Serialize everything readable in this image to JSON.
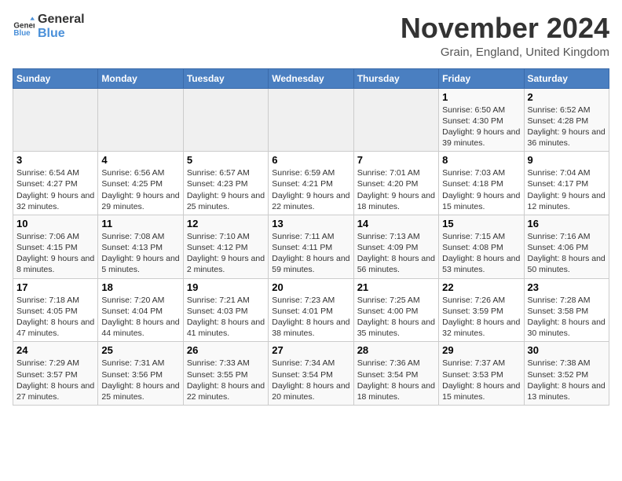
{
  "header": {
    "logo_line1": "General",
    "logo_line2": "Blue",
    "month": "November 2024",
    "location": "Grain, England, United Kingdom"
  },
  "weekdays": [
    "Sunday",
    "Monday",
    "Tuesday",
    "Wednesday",
    "Thursday",
    "Friday",
    "Saturday"
  ],
  "weeks": [
    [
      {
        "day": "",
        "info": ""
      },
      {
        "day": "",
        "info": ""
      },
      {
        "day": "",
        "info": ""
      },
      {
        "day": "",
        "info": ""
      },
      {
        "day": "",
        "info": ""
      },
      {
        "day": "1",
        "info": "Sunrise: 6:50 AM\nSunset: 4:30 PM\nDaylight: 9 hours and 39 minutes."
      },
      {
        "day": "2",
        "info": "Sunrise: 6:52 AM\nSunset: 4:28 PM\nDaylight: 9 hours and 36 minutes."
      }
    ],
    [
      {
        "day": "3",
        "info": "Sunrise: 6:54 AM\nSunset: 4:27 PM\nDaylight: 9 hours and 32 minutes."
      },
      {
        "day": "4",
        "info": "Sunrise: 6:56 AM\nSunset: 4:25 PM\nDaylight: 9 hours and 29 minutes."
      },
      {
        "day": "5",
        "info": "Sunrise: 6:57 AM\nSunset: 4:23 PM\nDaylight: 9 hours and 25 minutes."
      },
      {
        "day": "6",
        "info": "Sunrise: 6:59 AM\nSunset: 4:21 PM\nDaylight: 9 hours and 22 minutes."
      },
      {
        "day": "7",
        "info": "Sunrise: 7:01 AM\nSunset: 4:20 PM\nDaylight: 9 hours and 18 minutes."
      },
      {
        "day": "8",
        "info": "Sunrise: 7:03 AM\nSunset: 4:18 PM\nDaylight: 9 hours and 15 minutes."
      },
      {
        "day": "9",
        "info": "Sunrise: 7:04 AM\nSunset: 4:17 PM\nDaylight: 9 hours and 12 minutes."
      }
    ],
    [
      {
        "day": "10",
        "info": "Sunrise: 7:06 AM\nSunset: 4:15 PM\nDaylight: 9 hours and 8 minutes."
      },
      {
        "day": "11",
        "info": "Sunrise: 7:08 AM\nSunset: 4:13 PM\nDaylight: 9 hours and 5 minutes."
      },
      {
        "day": "12",
        "info": "Sunrise: 7:10 AM\nSunset: 4:12 PM\nDaylight: 9 hours and 2 minutes."
      },
      {
        "day": "13",
        "info": "Sunrise: 7:11 AM\nSunset: 4:11 PM\nDaylight: 8 hours and 59 minutes."
      },
      {
        "day": "14",
        "info": "Sunrise: 7:13 AM\nSunset: 4:09 PM\nDaylight: 8 hours and 56 minutes."
      },
      {
        "day": "15",
        "info": "Sunrise: 7:15 AM\nSunset: 4:08 PM\nDaylight: 8 hours and 53 minutes."
      },
      {
        "day": "16",
        "info": "Sunrise: 7:16 AM\nSunset: 4:06 PM\nDaylight: 8 hours and 50 minutes."
      }
    ],
    [
      {
        "day": "17",
        "info": "Sunrise: 7:18 AM\nSunset: 4:05 PM\nDaylight: 8 hours and 47 minutes."
      },
      {
        "day": "18",
        "info": "Sunrise: 7:20 AM\nSunset: 4:04 PM\nDaylight: 8 hours and 44 minutes."
      },
      {
        "day": "19",
        "info": "Sunrise: 7:21 AM\nSunset: 4:03 PM\nDaylight: 8 hours and 41 minutes."
      },
      {
        "day": "20",
        "info": "Sunrise: 7:23 AM\nSunset: 4:01 PM\nDaylight: 8 hours and 38 minutes."
      },
      {
        "day": "21",
        "info": "Sunrise: 7:25 AM\nSunset: 4:00 PM\nDaylight: 8 hours and 35 minutes."
      },
      {
        "day": "22",
        "info": "Sunrise: 7:26 AM\nSunset: 3:59 PM\nDaylight: 8 hours and 32 minutes."
      },
      {
        "day": "23",
        "info": "Sunrise: 7:28 AM\nSunset: 3:58 PM\nDaylight: 8 hours and 30 minutes."
      }
    ],
    [
      {
        "day": "24",
        "info": "Sunrise: 7:29 AM\nSunset: 3:57 PM\nDaylight: 8 hours and 27 minutes."
      },
      {
        "day": "25",
        "info": "Sunrise: 7:31 AM\nSunset: 3:56 PM\nDaylight: 8 hours and 25 minutes."
      },
      {
        "day": "26",
        "info": "Sunrise: 7:33 AM\nSunset: 3:55 PM\nDaylight: 8 hours and 22 minutes."
      },
      {
        "day": "27",
        "info": "Sunrise: 7:34 AM\nSunset: 3:54 PM\nDaylight: 8 hours and 20 minutes."
      },
      {
        "day": "28",
        "info": "Sunrise: 7:36 AM\nSunset: 3:54 PM\nDaylight: 8 hours and 18 minutes."
      },
      {
        "day": "29",
        "info": "Sunrise: 7:37 AM\nSunset: 3:53 PM\nDaylight: 8 hours and 15 minutes."
      },
      {
        "day": "30",
        "info": "Sunrise: 7:38 AM\nSunset: 3:52 PM\nDaylight: 8 hours and 13 minutes."
      }
    ]
  ]
}
